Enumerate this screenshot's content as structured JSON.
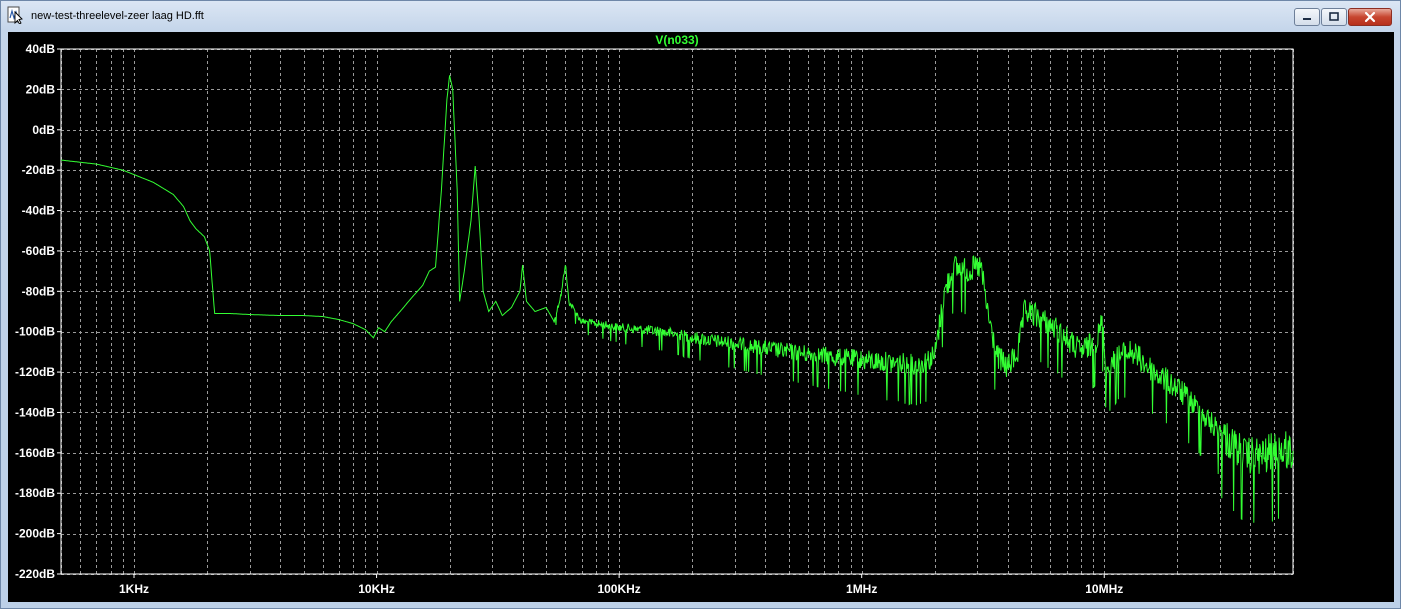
{
  "window": {
    "title": "new-test-threelevel-zeer laag HD.fft",
    "icons": {
      "app": "ltspice-waveform-icon",
      "minimize": "minimize-icon",
      "maximize": "maximize-icon",
      "close": "close-icon"
    }
  },
  "colors": {
    "plot_bg": "#000000",
    "trace": "#33ff33",
    "grid": "#9a9a9a",
    "axis_text": "#ffffff"
  },
  "chart_data": {
    "type": "line",
    "title": "V(n033)",
    "x_scale": "log",
    "y_unit": "dB",
    "xlim": [
      500,
      60000000
    ],
    "ylim": [
      -220,
      40
    ],
    "grid": true,
    "x_ticks": [
      {
        "value": 1000,
        "label": "1KHz"
      },
      {
        "value": 10000,
        "label": "10KHz"
      },
      {
        "value": 100000,
        "label": "100KHz"
      },
      {
        "value": 1000000,
        "label": "1MHz"
      },
      {
        "value": 10000000,
        "label": "10MHz"
      }
    ],
    "y_ticks": [
      {
        "value": 40,
        "label": "40dB"
      },
      {
        "value": 20,
        "label": "20dB"
      },
      {
        "value": 0,
        "label": "0dB"
      },
      {
        "value": -20,
        "label": "-20dB"
      },
      {
        "value": -40,
        "label": "-40dB"
      },
      {
        "value": -60,
        "label": "-60dB"
      },
      {
        "value": -80,
        "label": "-80dB"
      },
      {
        "value": -100,
        "label": "-100dB"
      },
      {
        "value": -120,
        "label": "-120dB"
      },
      {
        "value": -140,
        "label": "-140dB"
      },
      {
        "value": -160,
        "label": "-160dB"
      },
      {
        "value": -180,
        "label": "-180dB"
      },
      {
        "value": -200,
        "label": "-200dB"
      },
      {
        "value": -220,
        "label": "-220dB"
      }
    ],
    "series": [
      {
        "name": "V(n033)",
        "points": [
          [
            500,
            -15
          ],
          [
            700,
            -17
          ],
          [
            900,
            -20
          ],
          [
            1200,
            -26
          ],
          [
            1450,
            -32
          ],
          [
            1600,
            -38
          ],
          [
            1700,
            -45
          ],
          [
            1800,
            -49
          ],
          [
            1950,
            -53
          ],
          [
            2050,
            -60
          ],
          [
            2150,
            -91
          ],
          [
            2500,
            -91
          ],
          [
            3000,
            -91.5
          ],
          [
            4000,
            -92
          ],
          [
            5000,
            -92
          ],
          [
            6000,
            -92.5
          ],
          [
            7000,
            -94
          ],
          [
            8000,
            -96
          ],
          [
            9000,
            -99
          ],
          [
            9700,
            -103
          ],
          [
            10200,
            -98
          ],
          [
            10800,
            -100
          ],
          [
            11500,
            -95
          ],
          [
            12500,
            -90
          ],
          [
            14000,
            -83
          ],
          [
            15500,
            -77
          ],
          [
            16500,
            -70
          ],
          [
            17500,
            -68
          ],
          [
            18500,
            -30
          ],
          [
            19500,
            15
          ],
          [
            20000,
            27
          ],
          [
            20600,
            20
          ],
          [
            21500,
            -30
          ],
          [
            22000,
            -85
          ],
          [
            23000,
            -70
          ],
          [
            24500,
            -45
          ],
          [
            25500,
            -18
          ],
          [
            26500,
            -45
          ],
          [
            27500,
            -80
          ],
          [
            29000,
            -90
          ],
          [
            31000,
            -85
          ],
          [
            33000,
            -92
          ],
          [
            36000,
            -88
          ],
          [
            39000,
            -80
          ],
          [
            40000,
            -67
          ],
          [
            41500,
            -85
          ],
          [
            45000,
            -90
          ],
          [
            50000,
            -88
          ],
          [
            54000,
            -95
          ],
          [
            58000,
            -80
          ],
          [
            60000,
            -66
          ],
          [
            62000,
            -85
          ],
          [
            70000,
            -95
          ],
          [
            80000,
            -96
          ],
          [
            100000,
            -98
          ],
          [
            150000,
            -100
          ],
          [
            200000,
            -103
          ],
          [
            300000,
            -106
          ],
          [
            500000,
            -110
          ],
          [
            800000,
            -113
          ],
          [
            1200000,
            -115
          ],
          [
            1700000,
            -117
          ],
          [
            2000000,
            -112
          ],
          [
            2200000,
            -80
          ],
          [
            2400000,
            -68
          ],
          [
            2700000,
            -70
          ],
          [
            3100000,
            -68
          ],
          [
            3300000,
            -90
          ],
          [
            3600000,
            -112
          ],
          [
            4000000,
            -118
          ],
          [
            4400000,
            -110
          ],
          [
            4700000,
            -90
          ],
          [
            5200000,
            -92
          ],
          [
            6500000,
            -100
          ],
          [
            8000000,
            -110
          ],
          [
            9300000,
            -105
          ],
          [
            9800000,
            -95
          ],
          [
            10200000,
            -120
          ],
          [
            11500000,
            -112
          ],
          [
            13000000,
            -110
          ],
          [
            16000000,
            -120
          ],
          [
            20000000,
            -128
          ],
          [
            25000000,
            -140
          ],
          [
            30000000,
            -150
          ],
          [
            38000000,
            -162
          ],
          [
            45000000,
            -162
          ],
          [
            52000000,
            -159
          ],
          [
            60000000,
            -159
          ]
        ]
      }
    ]
  }
}
